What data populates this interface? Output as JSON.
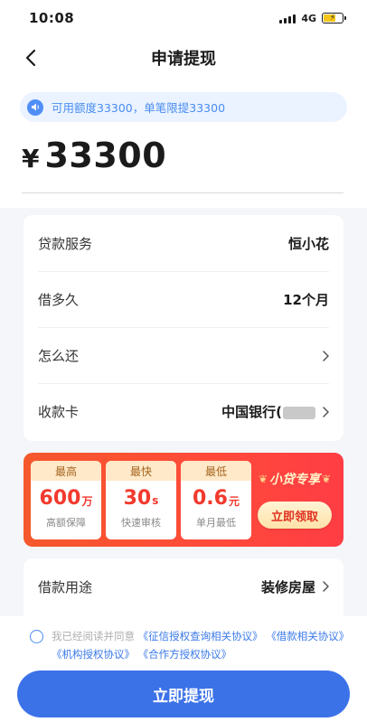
{
  "status_bar": {
    "time": "10:08",
    "network": "4G"
  },
  "nav": {
    "title": "申请提现"
  },
  "notice": {
    "text": "可用额度33300，单笔限提33300"
  },
  "amount": {
    "currency": "¥",
    "value": "33300"
  },
  "loan_info": {
    "rows": [
      {
        "label": "贷款服务",
        "value": "恒小花"
      },
      {
        "label": "借多久",
        "value": "12个月"
      },
      {
        "label": "怎么还",
        "value": ""
      },
      {
        "label": "收款卡",
        "value": "中国银行("
      }
    ]
  },
  "promo": {
    "tiles": [
      {
        "head": "最高",
        "value": "600",
        "unit": "万",
        "sub": "高额保障"
      },
      {
        "head": "最快",
        "value": "30",
        "unit": "s",
        "sub": "快速审核"
      },
      {
        "head": "最低",
        "value": "0.6",
        "unit": "元",
        "sub": "单月最低"
      }
    ],
    "title": "小贷专享",
    "button": "立即领取"
  },
  "purpose": {
    "label": "借款用途",
    "value": "装修房屋"
  },
  "agreement": {
    "prefix": "我已经阅读并同意",
    "links": [
      "《征信授权查询相关协议》",
      "《借款相关协议》",
      "《机构授权协议》",
      "《合作方授权协议》"
    ]
  },
  "submit": {
    "label": "立即提现"
  },
  "colors": {
    "primary": "#3c72e8",
    "promo": "#ff4a3a",
    "notice_bg": "#eaf3ff"
  }
}
